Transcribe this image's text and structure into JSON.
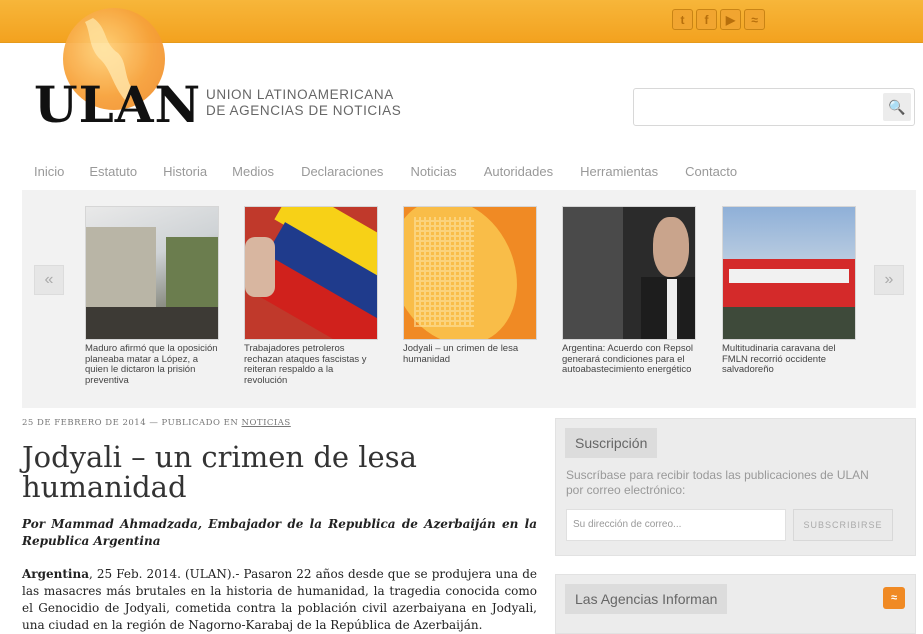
{
  "header": {
    "social_icons": [
      "twitter-icon",
      "facebook-icon",
      "youtube-icon",
      "rss-icon"
    ],
    "social_glyphs": [
      "t",
      "f",
      "▶",
      "≈"
    ],
    "logo_text": "ULAN",
    "logo_subtitle_line1": "UNION LATINOAMERICANA",
    "logo_subtitle_line2": "DE AGENCIAS DE NOTICIAS",
    "search_placeholder": "",
    "search_icon": "🔍"
  },
  "nav": {
    "items": [
      "Inicio",
      "Estatuto",
      "Historia",
      "Medios",
      "Declaraciones",
      "Noticias",
      "Autoridades",
      "Herramientas",
      "Contacto"
    ]
  },
  "carousel": {
    "prev": "«",
    "next": "»",
    "slides": [
      {
        "caption": "Maduro afirmó que la oposición planeaba matar a López, a quien le dictaron la prisión preventiva"
      },
      {
        "caption": "Trabajadores petroleros rechazan ataques fascistas y reiteran respaldo a la revolución"
      },
      {
        "caption": "Jodyali – un crimen de lesa humanidad"
      },
      {
        "caption": "Argentina: Acuerdo con Repsol generará condiciones para el autoabastecimiento energético"
      },
      {
        "caption": "Multitudinaria caravana del FMLN recorrió occidente salvadoreño"
      }
    ]
  },
  "article": {
    "date": "25 DE FEBRERO DE 2014",
    "separator": "—",
    "published_in": "PUBLICADO EN",
    "category": "NOTICIAS",
    "title": "Jodyali – un crimen de lesa humanidad",
    "byline": "Por Mammad Ahmadzada, Embajador de la Republica de Azerbaiján en la Republica Argentina",
    "lead_bold": "Argentina",
    "lead_text": ", 25 Feb. 2014. (ULAN).- Pasaron 22 años desde que se produjera una de las masacres más brutales en la historia de humanidad, la tragedia conocida como el Genocidio de Jodyali, cometida contra la población civil azerbaiyana en Jodyali, una ciudad en la región de Nagorno-Karabaj de la República de Azerbaiján."
  },
  "sidebar": {
    "subscription": {
      "title": "Suscripción",
      "text": "Suscríbase para recibir todas las publicaciones de ULAN por correo electrónico:",
      "email_placeholder": "Su dirección de correo...",
      "button": "SUBSCRIBIRSE"
    },
    "agencies": {
      "title": "Las Agencias Informan",
      "rss_glyph": "≈"
    }
  },
  "colors": {
    "topbar": "#f5ab2b",
    "accent_orange": "#f08a24",
    "nav_text": "#999999"
  }
}
